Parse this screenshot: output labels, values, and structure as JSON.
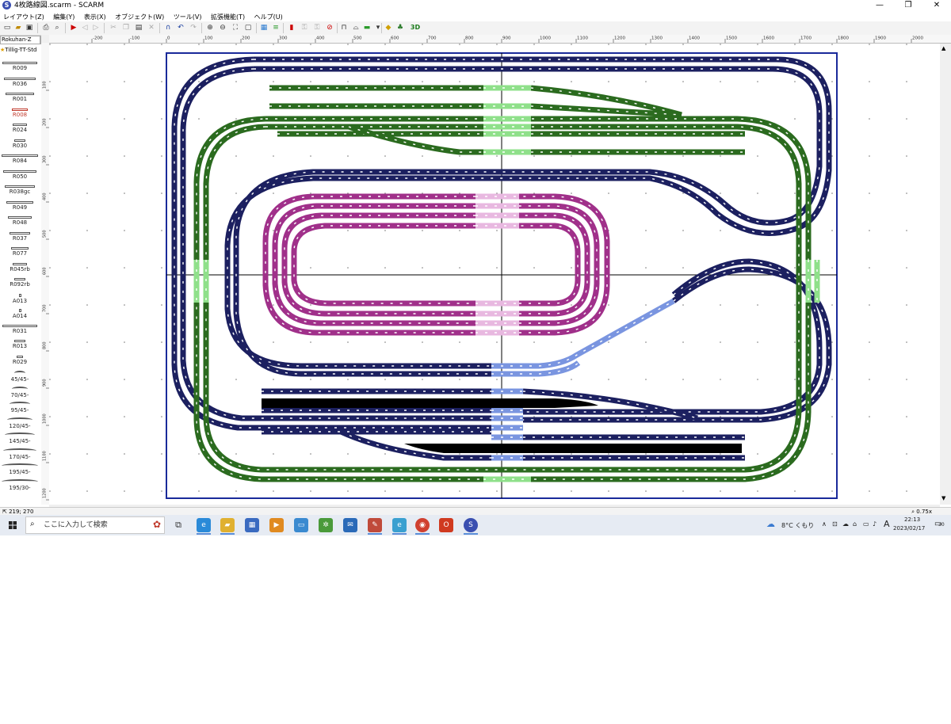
{
  "window": {
    "title": "4枚路線図.scarm - SCARM",
    "app_icon_letter": "S",
    "minimize": "—",
    "maximize": "❐",
    "close": "✕"
  },
  "menu": [
    "レイアウト(Z)",
    "編集(Y)",
    "表示(X)",
    "オブジェクト(W)",
    "ツール(V)",
    "拡張機能(T)",
    "ヘルプ(U)"
  ],
  "library": {
    "selected_library": "Rokuhan-Z",
    "secondary_library": "Tillig-TT-Std",
    "selected_part": "R008",
    "parts": [
      {
        "label": "R009",
        "kind": "straight",
        "w": 44
      },
      {
        "label": "R036",
        "kind": "straight",
        "w": 40
      },
      {
        "label": "R001",
        "kind": "straight",
        "w": 36
      },
      {
        "label": "R008",
        "kind": "straight",
        "w": 20
      },
      {
        "label": "R024",
        "kind": "straight",
        "w": 18
      },
      {
        "label": "R030",
        "kind": "straight",
        "w": 14
      },
      {
        "label": "R084",
        "kind": "straight",
        "w": 46
      },
      {
        "label": "R050",
        "kind": "straight",
        "w": 42
      },
      {
        "label": "R038gc",
        "kind": "straight",
        "w": 38
      },
      {
        "label": "R049",
        "kind": "straight",
        "w": 34
      },
      {
        "label": "R048",
        "kind": "straight",
        "w": 30
      },
      {
        "label": "R037",
        "kind": "straight",
        "w": 26
      },
      {
        "label": "R077",
        "kind": "straight",
        "w": 22
      },
      {
        "label": "R045rb",
        "kind": "straight",
        "w": 18
      },
      {
        "label": "R092rb",
        "kind": "straight",
        "w": 14
      },
      {
        "label": "A013",
        "kind": "dot",
        "w": 3
      },
      {
        "label": "A014",
        "kind": "dot",
        "w": 3
      },
      {
        "label": "R031",
        "kind": "straight",
        "w": 44
      },
      {
        "label": "R013",
        "kind": "straight",
        "w": 14
      },
      {
        "label": "R029",
        "kind": "straight",
        "w": 8
      },
      {
        "label": "45/45-",
        "kind": "curve",
        "w": 14
      },
      {
        "label": "70/45-",
        "kind": "curve",
        "w": 20
      },
      {
        "label": "95/45-",
        "kind": "curve",
        "w": 26
      },
      {
        "label": "120/45-",
        "kind": "curve",
        "w": 32
      },
      {
        "label": "145/45-",
        "kind": "curve",
        "w": 38
      },
      {
        "label": "170/45-",
        "kind": "curve",
        "w": 42
      },
      {
        "label": "195/45-",
        "kind": "curve",
        "w": 46
      },
      {
        "label": "195/30-",
        "kind": "curve",
        "w": 46
      }
    ]
  },
  "ruler": {
    "top_labels": [
      "-200",
      "-100",
      "0",
      "100",
      "200",
      "300",
      "400",
      "500",
      "600",
      "700",
      "800",
      "900",
      "1000",
      "1100",
      "1200",
      "1300",
      "1400",
      "1500",
      "1600",
      "1700",
      "1800",
      "1900",
      "2000"
    ],
    "left_labels": [
      "100",
      "200",
      "300",
      "400",
      "500",
      "600",
      "700",
      "800",
      "900",
      "1000",
      "1100",
      "1200"
    ]
  },
  "status": {
    "coordinates": "219; 270",
    "zoom": "0.75x"
  },
  "taskbar": {
    "search_placeholder": "ここに入力して検索",
    "weather": "8°C くもり",
    "ime": "A",
    "time": "22:13",
    "date": "2023/02/17",
    "notification_count": "30"
  },
  "colors": {
    "navy_track": "#1c2060",
    "green_track": "#2b6b1f",
    "light_green_track": "#8fe08a",
    "magenta_track": "#a0308a",
    "light_blue_track": "#7a95e0",
    "black_track": "#000000",
    "layout_border": "#1a2a9a"
  }
}
